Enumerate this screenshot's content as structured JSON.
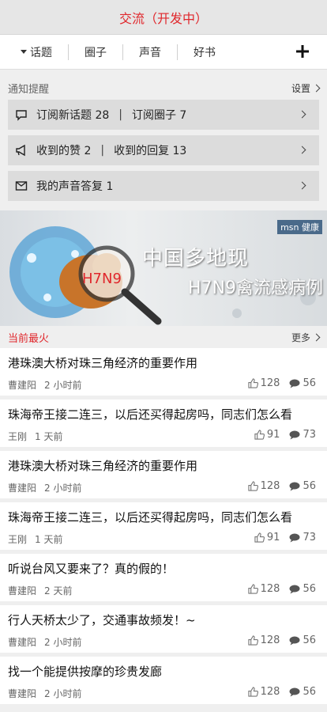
{
  "header": {
    "title": "交流（开发中）"
  },
  "tabs": [
    {
      "label": "话题"
    },
    {
      "label": "圈子"
    },
    {
      "label": "声音"
    },
    {
      "label": "好书"
    }
  ],
  "notifications": {
    "title": "通知提醒",
    "settings_label": "设置",
    "rows": [
      {
        "icon": "comment-icon",
        "left": "订阅新话题 28",
        "right": "订阅圈子 7"
      },
      {
        "icon": "megaphone-icon",
        "left": "收到的赞 2",
        "right": "收到的回复 13"
      },
      {
        "icon": "envelope-icon",
        "left": "我的声音答复 1",
        "right": ""
      }
    ]
  },
  "banner": {
    "line1": "中国多地现",
    "line2": "H7N9禽流感病例",
    "badge": "H7N9",
    "logo": "msn 健康"
  },
  "hot": {
    "title": "当前最火",
    "more_label": "更多",
    "items": [
      {
        "title": "港珠澳大桥对珠三角经济的重要作用",
        "author": "曹建阳",
        "time": "2 小时前",
        "likes": "128",
        "comments": "56"
      },
      {
        "title": "珠海帝王接二连三，以后还买得起房吗，同志们怎么看",
        "author": "王刚",
        "time": "1 天前",
        "likes": "91",
        "comments": "73"
      },
      {
        "title": "港珠澳大桥对珠三角经济的重要作用",
        "author": "曹建阳",
        "time": "2 小时前",
        "likes": "128",
        "comments": "56"
      },
      {
        "title": "珠海帝王接二连三，以后还买得起房吗，同志们怎么看",
        "author": "王刚",
        "time": "1 天前",
        "likes": "91",
        "comments": "73"
      },
      {
        "title": "听说台风又要来了？真的假的！",
        "author": "曹建阳",
        "time": "2 天前",
        "likes": "128",
        "comments": "56"
      },
      {
        "title": "行人天桥太少了，交通事故频发！~",
        "author": "曹建阳",
        "time": "2 小时前",
        "likes": "128",
        "comments": "56"
      },
      {
        "title": "找一个能提供按摩的珍贵发廊",
        "author": "曹建阳",
        "time": "2 小时前",
        "likes": "128",
        "comments": "56"
      }
    ]
  }
}
